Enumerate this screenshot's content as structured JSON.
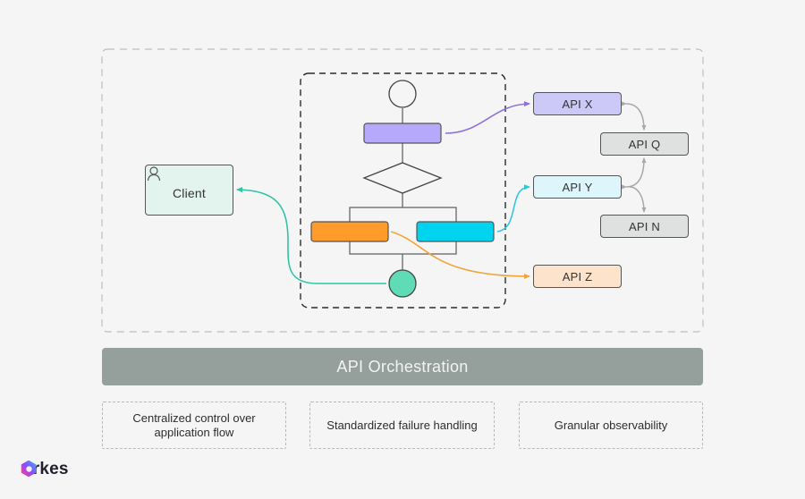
{
  "diagram": {
    "client": {
      "label": "Client",
      "icon": "user-icon"
    },
    "apis": {
      "x": {
        "label": "API X",
        "color": "#ccc8f7"
      },
      "q": {
        "label": "API Q",
        "color": "#dfe1e1"
      },
      "y": {
        "label": "API Y",
        "color": "#dcf6fb"
      },
      "n": {
        "label": "API N",
        "color": "#dfe1e1"
      },
      "z": {
        "label": "API Z",
        "color": "#fde2cc"
      }
    },
    "workflow": {
      "task_colors": {
        "purple": "#b6a8fb",
        "orange": "#ff9b2a",
        "cyan": "#00d3ee",
        "end": "#5fdcb6"
      },
      "connector_colors": {
        "purple": "#8f72d9",
        "cyan": "#2fc7da",
        "orange": "#f0a43a",
        "teal": "#2ec4a6",
        "gray": "#a8a8a8"
      }
    }
  },
  "banner": {
    "label": "API Orchestration",
    "color": "#959f9c"
  },
  "features": [
    {
      "label": "Centralized control over application flow"
    },
    {
      "label": "Standardized failure handling"
    },
    {
      "label": "Granular observability"
    }
  ],
  "brand": {
    "name": "orkes"
  }
}
